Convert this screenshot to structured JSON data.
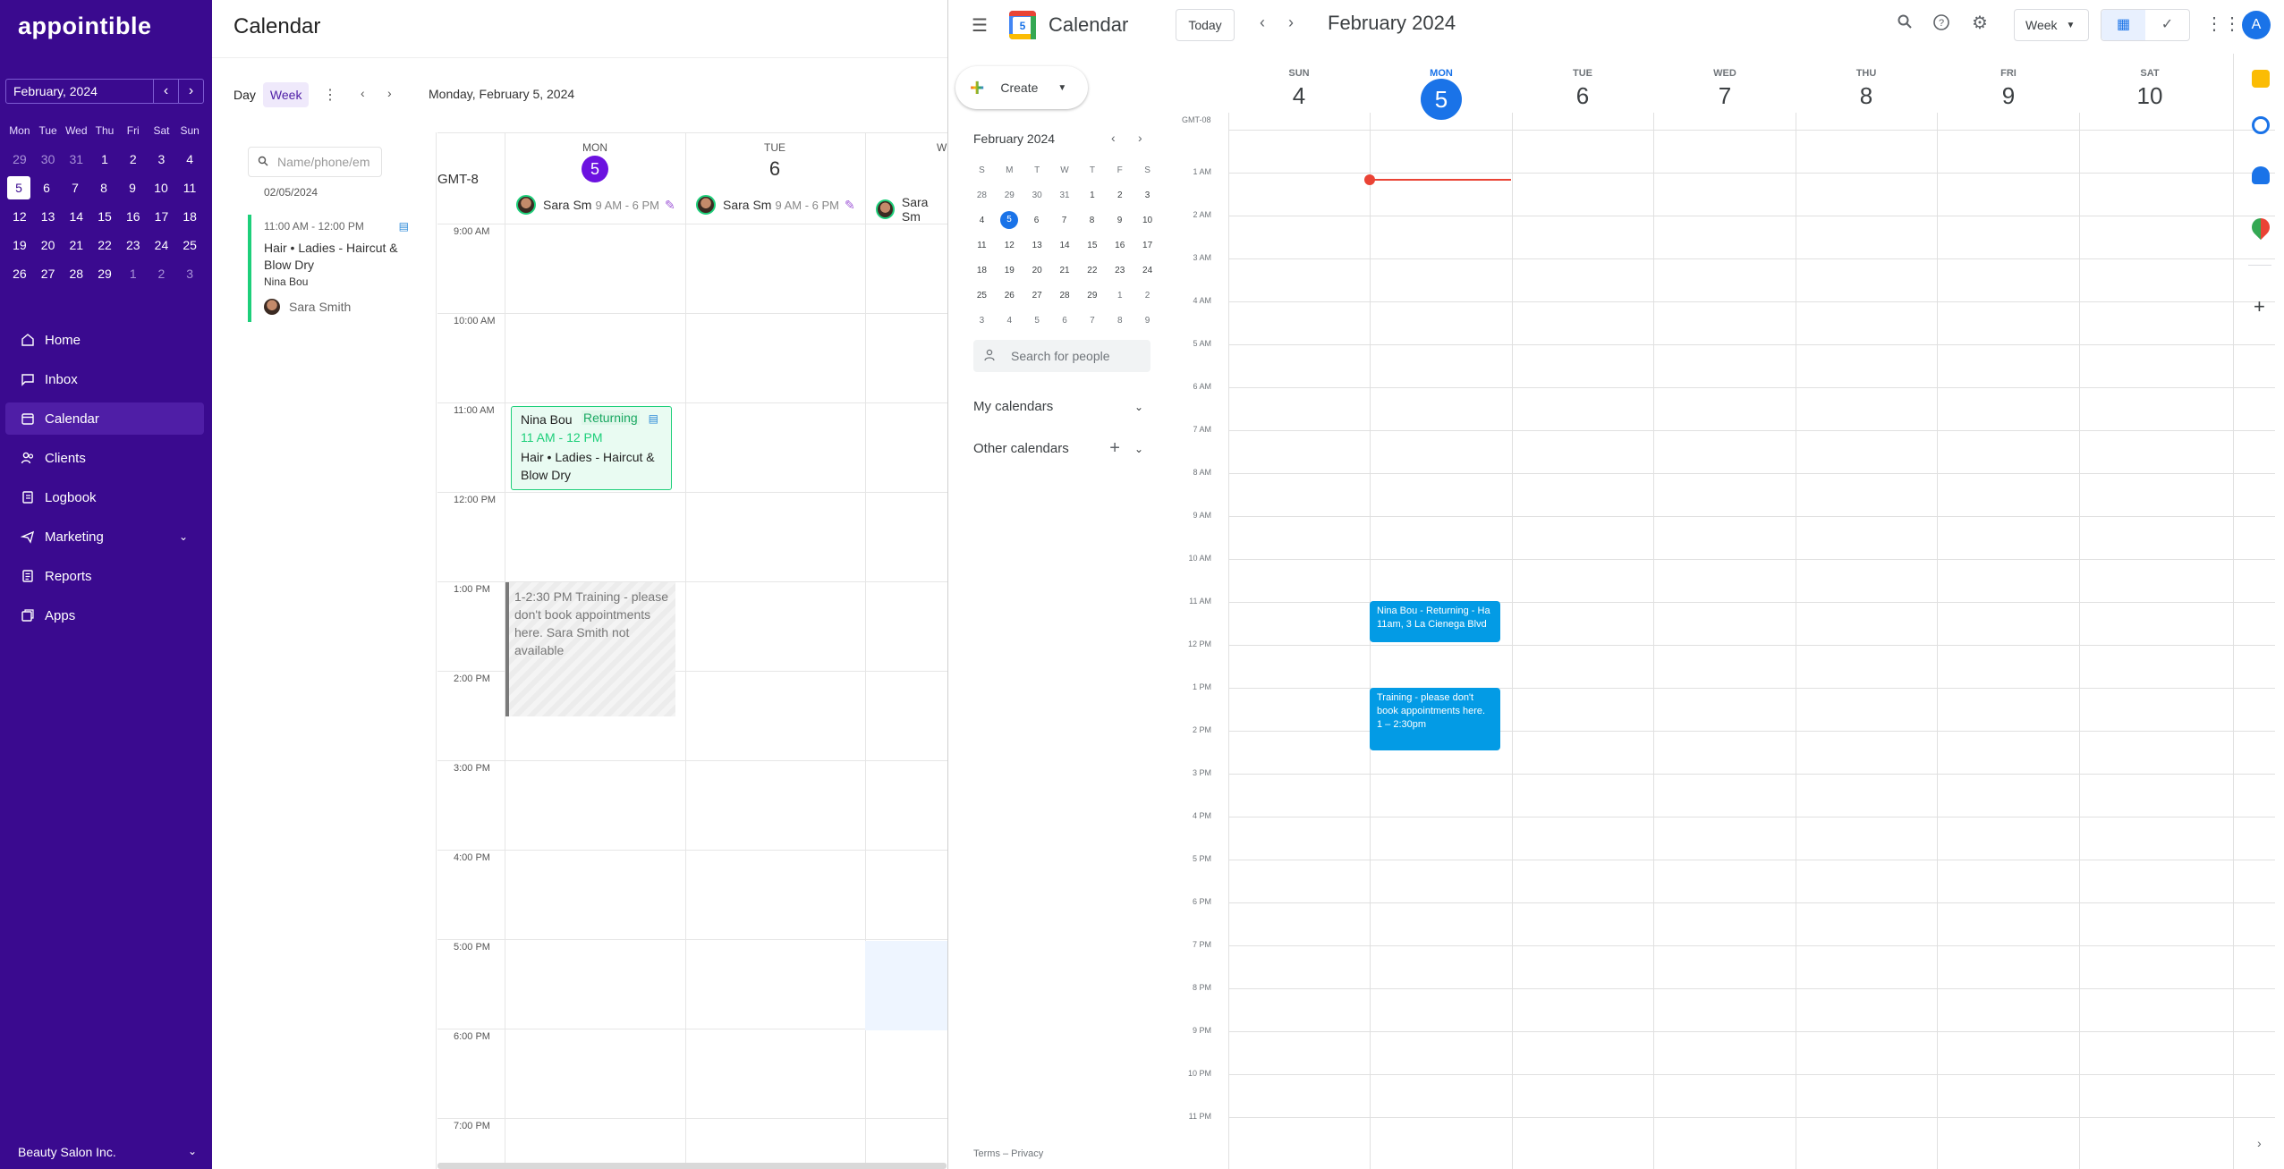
{
  "app": {
    "logo": "appointible",
    "mini_calendar": {
      "month_label": "February, 2024",
      "dow": [
        "Mon",
        "Tue",
        "Wed",
        "Thu",
        "Fri",
        "Sat",
        "Sun"
      ],
      "weeks": [
        [
          "29",
          "30",
          "31",
          "1",
          "2",
          "3",
          "4"
        ],
        [
          "5",
          "6",
          "7",
          "8",
          "9",
          "10",
          "11"
        ],
        [
          "12",
          "13",
          "14",
          "15",
          "16",
          "17",
          "18"
        ],
        [
          "19",
          "20",
          "21",
          "22",
          "23",
          "24",
          "25"
        ],
        [
          "26",
          "27",
          "28",
          "29",
          "1",
          "2",
          "3"
        ]
      ],
      "selected": "5"
    },
    "nav": [
      {
        "label": "Home",
        "icon": "home-icon"
      },
      {
        "label": "Inbox",
        "icon": "inbox-icon"
      },
      {
        "label": "Calendar",
        "icon": "calendar-icon",
        "active": true
      },
      {
        "label": "Clients",
        "icon": "clients-icon"
      },
      {
        "label": "Logbook",
        "icon": "logbook-icon"
      },
      {
        "label": "Marketing",
        "icon": "marketing-icon",
        "expandable": true
      },
      {
        "label": "Reports",
        "icon": "reports-icon"
      },
      {
        "label": "Apps",
        "icon": "apps-icon"
      }
    ],
    "org_name": "Beauty Salon Inc.",
    "accent": "#3a0a8f"
  },
  "booking": {
    "title": "Calendar",
    "view_day": "Day",
    "view_week": "Week",
    "current_date": "Monday, February 5, 2024",
    "search_placeholder": "Name/phone/em",
    "side_date": "02/05/2024",
    "side_appt": {
      "time": "11:00 AM - 12:00 PM",
      "service": "Hair • Ladies - Haircut & Blow Dry",
      "client": "Nina Bou",
      "staff": "Sara Smith"
    },
    "timezone": "GMT-8",
    "days": [
      {
        "dow": "MON",
        "num": "5",
        "today": true,
        "staff": "Sara Sm",
        "hours": "9 AM - 6 PM"
      },
      {
        "dow": "TUE",
        "num": "6",
        "today": false,
        "staff": "Sara Sm",
        "hours": "9 AM - 6 PM"
      },
      {
        "dow": "W",
        "num": "",
        "today": false,
        "staff": "Sara Sm",
        "hours": ""
      }
    ],
    "hours": [
      "9:00 AM",
      "10:00 AM",
      "11:00 AM",
      "12:00 PM",
      "1:00 PM",
      "2:00 PM",
      "3:00 PM",
      "4:00 PM",
      "5:00 PM",
      "6:00 PM",
      "7:00 PM"
    ],
    "appointment": {
      "client": "Nina Bou",
      "tag": "Returning",
      "time": "11 AM - 12 PM",
      "service": "Hair • Ladies - Haircut & Blow Dry",
      "color": "#1dcf7a"
    },
    "block": {
      "text": "1-2:30 PM Training - please don't book appointments here. Sara Smith not available"
    }
  },
  "gcal": {
    "title": "Calendar",
    "logo_day": "5",
    "today_button": "Today",
    "month": "February 2024",
    "view": "Week",
    "account_initial": "A",
    "create_label": "Create",
    "mini": {
      "title": "February 2024",
      "dow": [
        "S",
        "M",
        "T",
        "W",
        "T",
        "F",
        "S"
      ],
      "weeks": [
        [
          "28",
          "29",
          "30",
          "31",
          "1",
          "2",
          "3"
        ],
        [
          "4",
          "5",
          "6",
          "7",
          "8",
          "9",
          "10"
        ],
        [
          "11",
          "12",
          "13",
          "14",
          "15",
          "16",
          "17"
        ],
        [
          "18",
          "19",
          "20",
          "21",
          "22",
          "23",
          "24"
        ],
        [
          "25",
          "26",
          "27",
          "28",
          "29",
          "1",
          "2"
        ],
        [
          "3",
          "4",
          "5",
          "6",
          "7",
          "8",
          "9"
        ]
      ],
      "selected": "5"
    },
    "people_placeholder": "Search for people",
    "my_calendars": "My calendars",
    "other_calendars": "Other calendars",
    "footer": "Terms – Privacy",
    "timezone": "GMT-08",
    "days": [
      {
        "dow": "SUN",
        "num": "4"
      },
      {
        "dow": "MON",
        "num": "5",
        "today": true
      },
      {
        "dow": "TUE",
        "num": "6"
      },
      {
        "dow": "WED",
        "num": "7"
      },
      {
        "dow": "THU",
        "num": "8"
      },
      {
        "dow": "FRI",
        "num": "9"
      },
      {
        "dow": "SAT",
        "num": "10"
      }
    ],
    "hours": [
      "1 AM",
      "2 AM",
      "3 AM",
      "4 AM",
      "5 AM",
      "6 AM",
      "7 AM",
      "8 AM",
      "9 AM",
      "10 AM",
      "11 AM",
      "12 PM",
      "1 PM",
      "2 PM",
      "3 PM",
      "4 PM",
      "5 PM",
      "6 PM",
      "7 PM",
      "8 PM",
      "9 PM",
      "10 PM",
      "11 PM"
    ],
    "events": [
      {
        "title": "Nina Bou - Returning - Ha",
        "detail": "11am, 3 La Cienega Blvd"
      },
      {
        "title": "Training - please don't",
        "title2": "book appointments here.",
        "detail": "1 – 2:30pm"
      }
    ],
    "event_color": "#039be5",
    "accent": "#1a73e8"
  }
}
